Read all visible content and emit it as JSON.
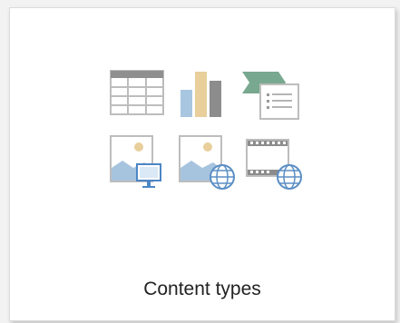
{
  "tile": {
    "label": "Content types"
  },
  "icons": [
    {
      "name": "table-icon"
    },
    {
      "name": "chart-icon"
    },
    {
      "name": "slide-content-icon"
    },
    {
      "name": "picture-computer-icon"
    },
    {
      "name": "picture-web-icon"
    },
    {
      "name": "video-web-icon"
    }
  ],
  "colors": {
    "gray": "#cfcfcf",
    "dark_gray": "#8c8c8c",
    "blue": "#a9c6e0",
    "tan": "#e8cf9b",
    "green": "#78a88f",
    "light_blue": "#a7c4df",
    "globe_blue": "#5b8fc4",
    "accent_blue": "#4c86c6"
  }
}
